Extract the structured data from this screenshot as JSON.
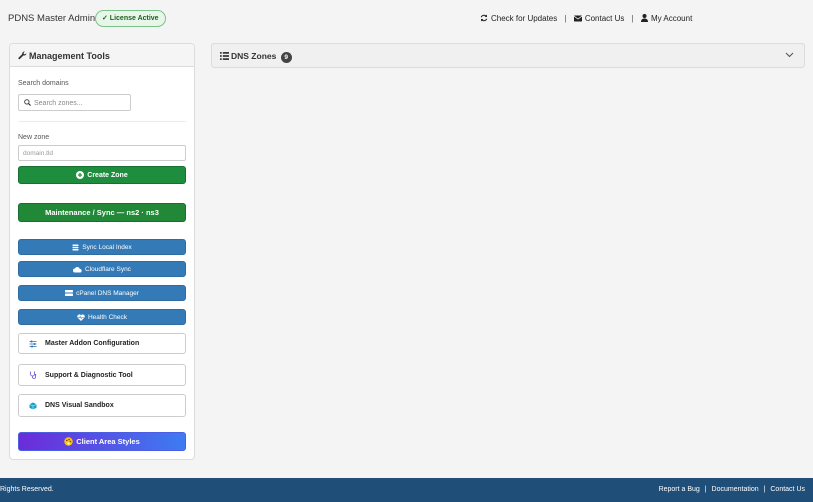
{
  "header": {
    "app_title": "PDNS Master Admin",
    "license_badge": "✓ License Active",
    "links": {
      "check_updates": "Check for Updates",
      "contact": "Contact Us",
      "account": "My Account",
      "separator": "|"
    }
  },
  "sidebar": {
    "title": "Management Tools",
    "search_label": "Search domains",
    "search_placeholder": "Search zones...",
    "new_zone_label": "New zone",
    "new_zone_placeholder": "domain.tld",
    "create_zone": "Create Zone",
    "maintenance": "Maintenance / Sync — ns2 · ns3",
    "sync_local_index": "Sync Local Index",
    "cloudflare_sync": "Cloudflare Sync",
    "cpanel_manager": "cPanel DNS Manager",
    "health_check": "Health Check",
    "addon_config": "Master Addon Configuration",
    "support_tool": "Support & Diagnostic Tool",
    "visual_sandbox": "DNS Visual Sandbox",
    "client_styles": "Client Area Styles"
  },
  "zones": {
    "title": "DNS Zones",
    "count": "9"
  },
  "footer": {
    "left_text": "Rights Reserved.",
    "report_bug": "Report a Bug",
    "documentation": "Documentation",
    "contact": "Contact Us",
    "separator": "|"
  },
  "colors": {
    "green": "#1e8e3e",
    "blue": "#337ab7",
    "footer": "#1f4e79",
    "gradient_start": "#6c2bd9",
    "gradient_end": "#3d7cf2"
  }
}
